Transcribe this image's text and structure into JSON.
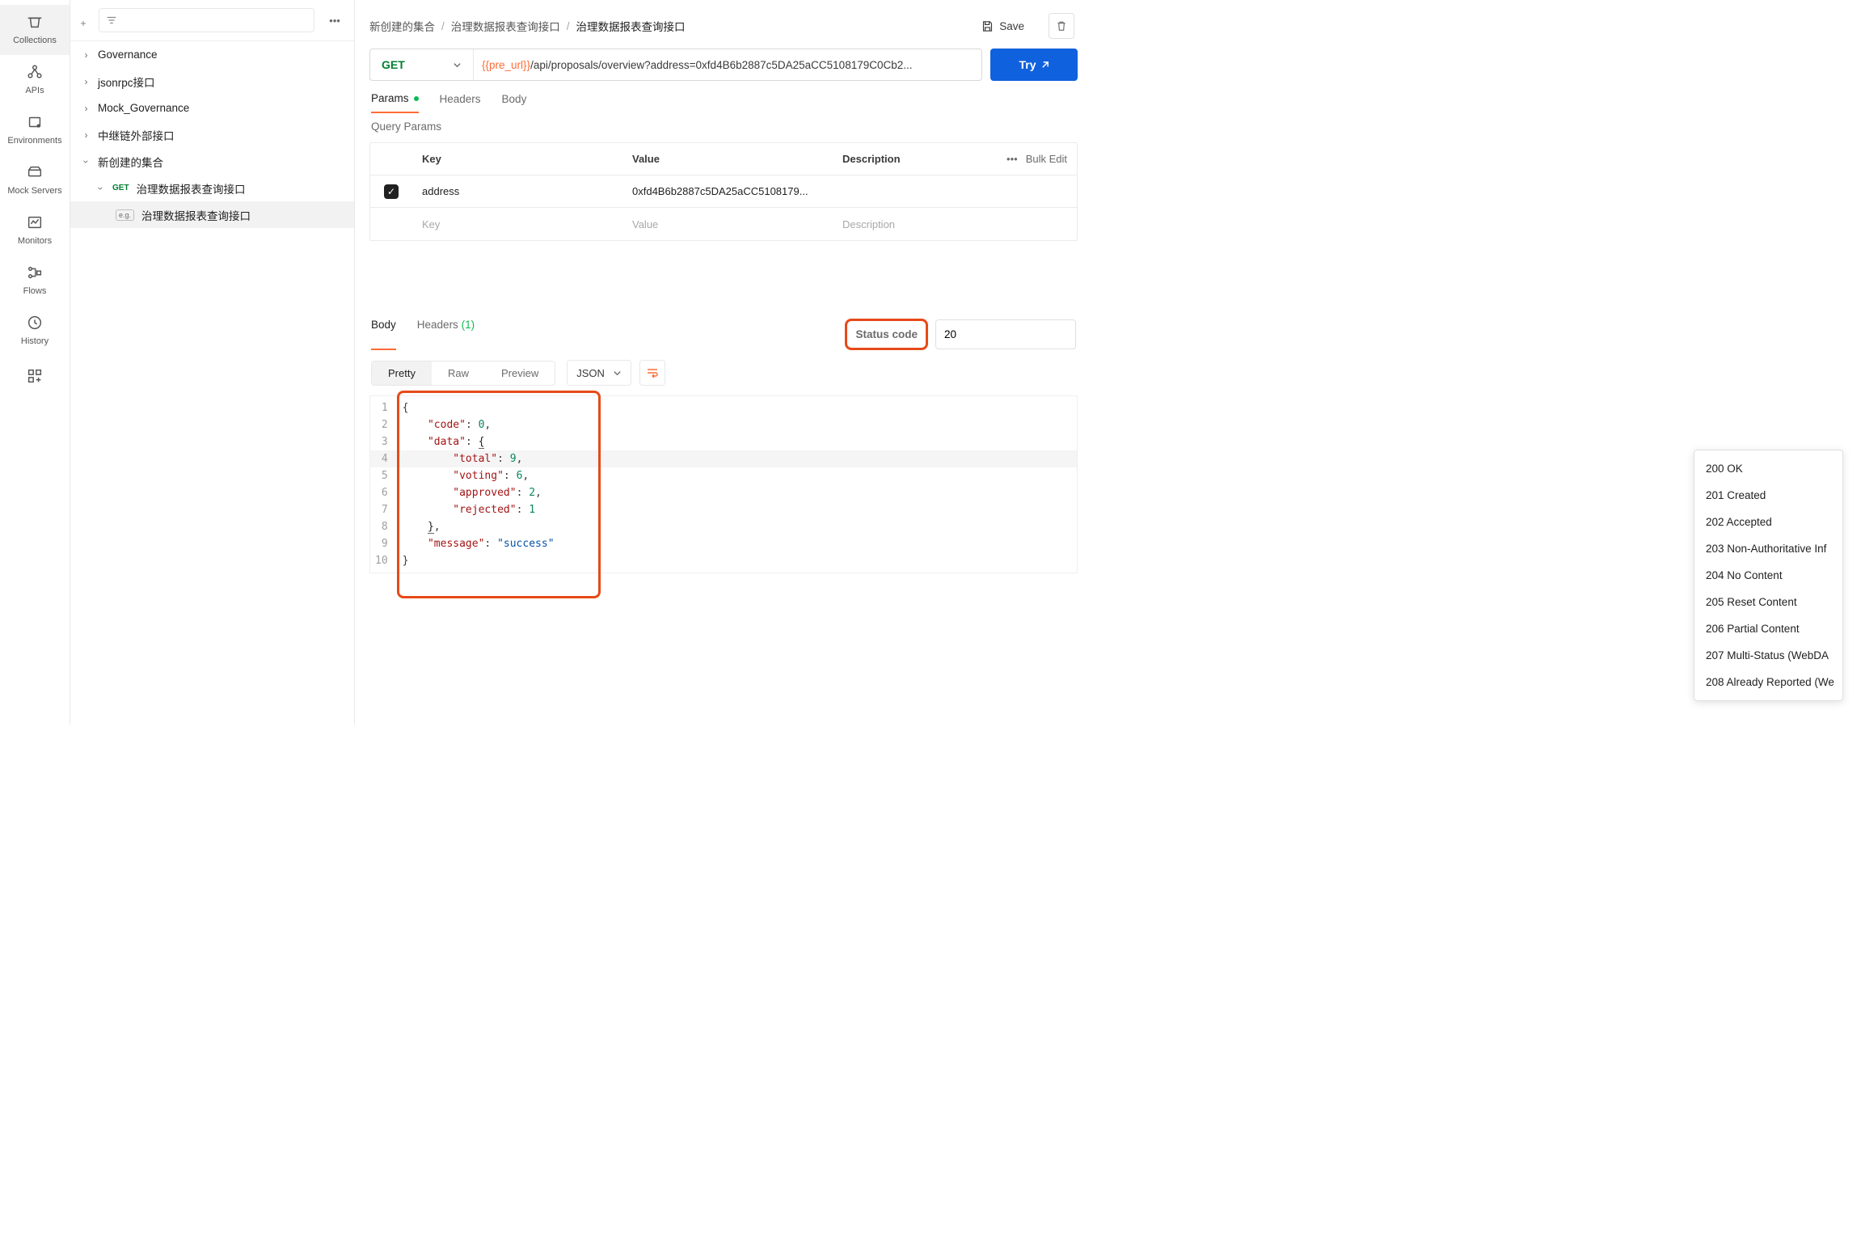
{
  "nav": {
    "items": [
      {
        "label": "Collections",
        "icon": "collections"
      },
      {
        "label": "APIs",
        "icon": "apis"
      },
      {
        "label": "Environments",
        "icon": "env"
      },
      {
        "label": "Mock Servers",
        "icon": "mock"
      },
      {
        "label": "Monitors",
        "icon": "monitors"
      },
      {
        "label": "Flows",
        "icon": "flows"
      },
      {
        "label": "History",
        "icon": "history"
      }
    ]
  },
  "sidebar": {
    "items": [
      {
        "label": "Governance",
        "lv": 0,
        "open": false
      },
      {
        "label": "jsonrpc接口",
        "lv": 0,
        "open": false
      },
      {
        "label": "Mock_Governance",
        "lv": 0,
        "open": false
      },
      {
        "label": "中继链外部接口",
        "lv": 0,
        "open": false
      },
      {
        "label": "新创建的集合",
        "lv": 0,
        "open": true
      },
      {
        "label": "治理数据报表查询接口",
        "lv": 1,
        "open": true,
        "method": "GET"
      },
      {
        "label": "治理数据报表查询接口",
        "lv": 2,
        "eg": true,
        "sel": true
      }
    ]
  },
  "crumb": {
    "a": "新创建的集合",
    "b": "治理数据报表查询接口",
    "c": "治理数据报表查询接口",
    "save": "Save"
  },
  "url": {
    "method": "GET",
    "pre": "{{pre_url}}",
    "path": "/api/proposals/overview?address=0xfd4B6b2887c5DA25aCC5108179C0Cb2...",
    "try": "Try"
  },
  "reqTabs": {
    "a": "Params",
    "b": "Headers",
    "c": "Body"
  },
  "qp": {
    "title": "Query Params",
    "hk": "Key",
    "hv": "Value",
    "hd": "Description",
    "bulk": "Bulk Edit",
    "rows": [
      {
        "k": "address",
        "v": "0xfd4B6b2887c5DA25aCC5108179..."
      }
    ],
    "ph": {
      "k": "Key",
      "v": "Value",
      "d": "Description"
    }
  },
  "respTabs": {
    "a": "Body",
    "b": "Headers",
    "bc": "(1)"
  },
  "status": {
    "label": "Status code",
    "input": "20"
  },
  "view": {
    "a": "Pretty",
    "b": "Raw",
    "c": "Preview",
    "fmt": "JSON"
  },
  "jsonBody": {
    "line1": "{",
    "k_code": "\"code\"",
    "v_code": "0",
    "k_data": "\"data\"",
    "k_total": "\"total\"",
    "v_total": "9",
    "k_voting": "\"voting\"",
    "v_voting": "6",
    "k_approved": "\"approved\"",
    "v_approved": "2",
    "k_rejected": "\"rejected\"",
    "v_rejected": "1",
    "k_msg": "\"message\"",
    "v_msg": "\"success\""
  },
  "dropdown": [
    "200 OK",
    "201 Created",
    "202 Accepted",
    "203 Non-Authoritative Inf",
    "204 No Content",
    "205 Reset Content",
    "206 Partial Content",
    "207 Multi-Status (WebDA",
    "208 Already Reported (We"
  ]
}
